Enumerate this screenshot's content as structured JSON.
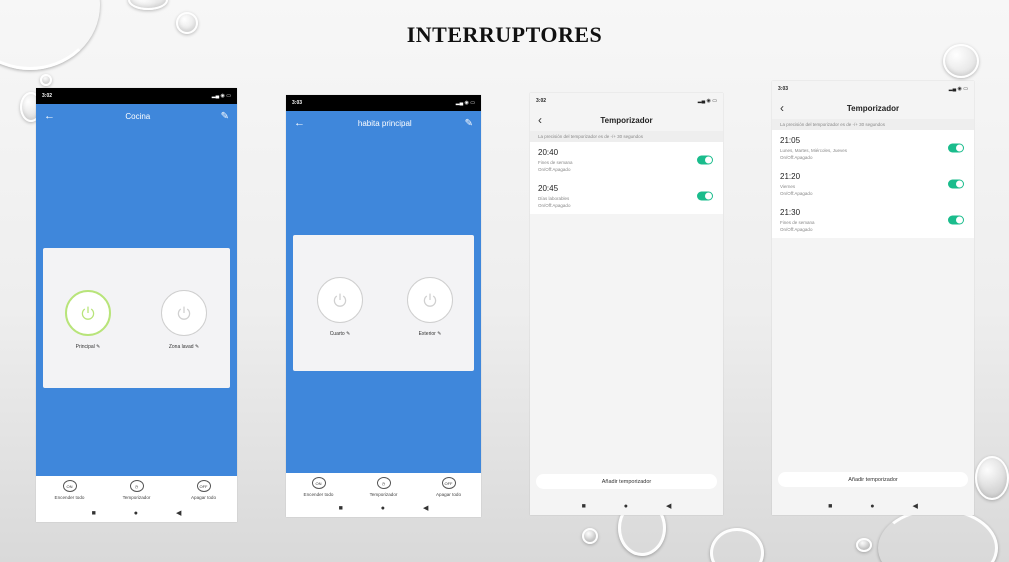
{
  "slide_title": "INTERRUPTORES",
  "colors": {
    "app_blue": "#3f87db",
    "toggle_on": "#1abc8c",
    "power_on_ring": "#b8e47a"
  },
  "screens": [
    {
      "status_time": "3:02",
      "room_title": "Cocina",
      "switches": [
        {
          "label": "Principal",
          "state": "on"
        },
        {
          "label": "Zona lavad",
          "state": "off"
        }
      ],
      "actions": [
        {
          "icon_text": "ON",
          "label": "Encender todo"
        },
        {
          "icon_text": "",
          "label": "Temporizador"
        },
        {
          "icon_text": "OFF",
          "label": "Apagar todo"
        }
      ]
    },
    {
      "status_time": "3:03",
      "room_title": "habita principal",
      "switches": [
        {
          "label": "Cuarto",
          "state": "off"
        },
        {
          "label": "Exterior",
          "state": "off"
        }
      ],
      "actions": [
        {
          "icon_text": "ON",
          "label": "Encender todo"
        },
        {
          "icon_text": "",
          "label": "Temporizador"
        },
        {
          "icon_text": "OFF",
          "label": "Apagar todo"
        }
      ]
    },
    {
      "status_time": "3:02",
      "title": "Temporizador",
      "note": "La precisión del temporizador es de -/+ 30 segundos",
      "timers": [
        {
          "time": "20:40",
          "days": "Fines de semana",
          "action": "On/Off:Apagado",
          "enabled": true
        },
        {
          "time": "20:45",
          "days": "Días laborables",
          "action": "On/Off:Apagado",
          "enabled": true
        }
      ],
      "add_label": "Añadir temporizador"
    },
    {
      "status_time": "3:03",
      "title": "Temporizador",
      "note": "La precisión del temporizador es de -/+ 30 segundos",
      "timers": [
        {
          "time": "21:05",
          "days": "Lunes, Martes, Miércoles, Jueves",
          "action": "On/Off:Apagado",
          "enabled": true
        },
        {
          "time": "21:20",
          "days": "Viernes",
          "action": "On/Off:Apagado",
          "enabled": true
        },
        {
          "time": "21:30",
          "days": "Fines de semana",
          "action": "On/Off:Apagado",
          "enabled": true
        }
      ],
      "add_label": "Añadir temporizador"
    }
  ]
}
